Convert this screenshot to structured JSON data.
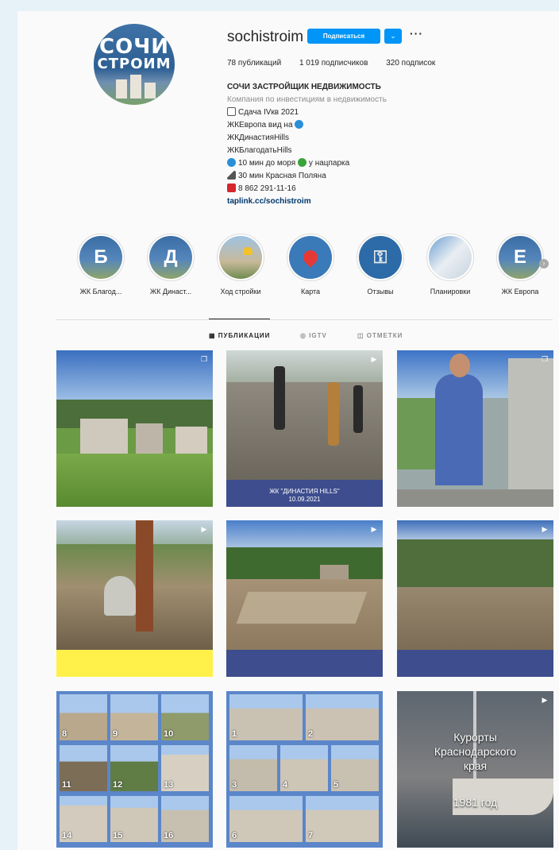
{
  "profile": {
    "avatar_line1": "СОЧИ",
    "avatar_line2": "СТРОИМ",
    "username": "sochistroim",
    "subscribe_label": "Подписаться",
    "dropdown_glyph": "⌄",
    "more_glyph": "···",
    "stats": {
      "posts": "78 публикаций",
      "followers": "1 019 подписчиков",
      "following": "320 подписок"
    },
    "bio": {
      "title": "СОЧИ ЗАСТРОЙЩИК НЕДВИЖИМОСТЬ",
      "category": "Компания по инвестициям в недвижимость",
      "line1": "Сдача IVкв 2021",
      "line2": "ЖКЕвропа вид на",
      "line3": "ЖКДинастияHills",
      "line4": "ЖКБлагодатьHills",
      "line5a": "10 мин до моря",
      "line5b": "у нацпарка",
      "line6": "30 мин Красная Поляна",
      "line7": "8 862 291-11-16",
      "link": "taplink.cc/sochistroim"
    }
  },
  "highlights": [
    {
      "letter": "Б",
      "label": "ЖК Благод..."
    },
    {
      "letter": "Д",
      "label": "ЖК Династ..."
    },
    {
      "letter": "",
      "label": "Ход стройки"
    },
    {
      "letter": "",
      "label": "Карта"
    },
    {
      "letter": "",
      "label": "Отзывы"
    },
    {
      "letter": "",
      "label": "Планировки"
    },
    {
      "letter": "Е",
      "label": "ЖК Европа"
    }
  ],
  "tabs": {
    "posts": "ПУБЛИКАЦИИ",
    "igtv": "IGTV",
    "tagged": "ОТМЕТКИ"
  },
  "posts": {
    "p2_line1": "ЖК \"ДИНАСТИЯ HILLS\"",
    "p2_line2": "10.09.2021",
    "collage1": [
      "8",
      "9",
      "10",
      "11",
      "12",
      "13",
      "14",
      "15",
      "16"
    ],
    "collage2": [
      "1",
      "2",
      "3",
      "4",
      "5",
      "6",
      "7"
    ],
    "retro_line1": "Курорты",
    "retro_line2": "Краснодарского",
    "retro_line3": "края",
    "retro_line4": "1981 год"
  },
  "colors": {
    "accent": "#0095f6",
    "band_blue": "#3d4d8e",
    "band_yellow": "#fff04a"
  },
  "icons": {
    "carousel": "carousel-icon",
    "video": "video-play-icon"
  }
}
